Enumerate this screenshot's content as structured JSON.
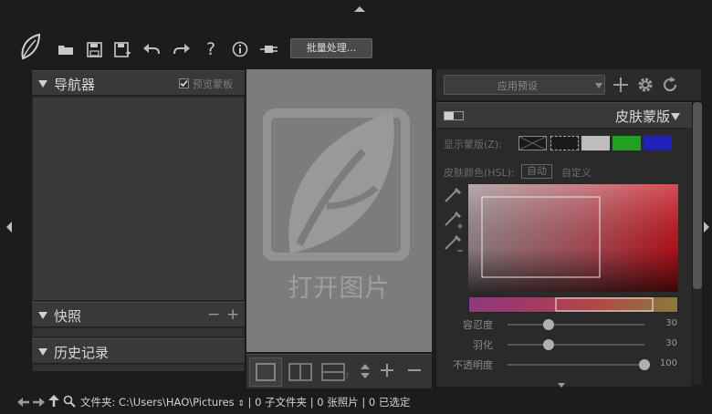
{
  "toolbar": {
    "batch_label": "批量处理..."
  },
  "left": {
    "navigator": {
      "title": "导航器",
      "preview_label": "预览蒙板",
      "preview_checked": true
    },
    "snapshot": {
      "title": "快照",
      "minus": "−",
      "plus": "+"
    },
    "history": {
      "title": "历史记录"
    }
  },
  "center": {
    "open_label": "打开图片"
  },
  "right": {
    "preset_placeholder": "应用预设",
    "skin_mask": {
      "title": "皮肤蒙版",
      "show_mask_label": "显示蒙版(Z):",
      "swatch_colors": [
        "#1a1a1a",
        "#1a1a1a",
        "#bdbdbd",
        "#22a022",
        "#2121b8"
      ],
      "hsl_label": "皮肤颜色(HSL):",
      "auto_label": "自动",
      "custom_label": "自定义",
      "sliders": [
        {
          "label": "容忍度",
          "value": "30",
          "fraction": 0.3
        },
        {
          "label": "羽化",
          "value": "30",
          "fraction": 0.3
        },
        {
          "label": "不透明度",
          "value": "100",
          "fraction": 1.0
        }
      ]
    }
  },
  "status": {
    "folder_label": "文件夹:",
    "path": "C:\\Users\\HAO\\Pictures",
    "subfolders": "0 子文件夹",
    "photos": "0 张照片",
    "selected": "0 已选定"
  },
  "icons": [
    "app-leaf-icon",
    "folder-open-icon",
    "save-icon",
    "save-as-icon",
    "undo-icon",
    "redo-icon",
    "help-icon",
    "info-icon",
    "plugin-icon",
    "plus-icon",
    "gear-icon",
    "refresh-icon",
    "eyedropper-icon",
    "eyedropper-plus-icon",
    "eyedropper-minus-icon",
    "back-icon",
    "forward-icon",
    "up-icon",
    "search-icon"
  ]
}
